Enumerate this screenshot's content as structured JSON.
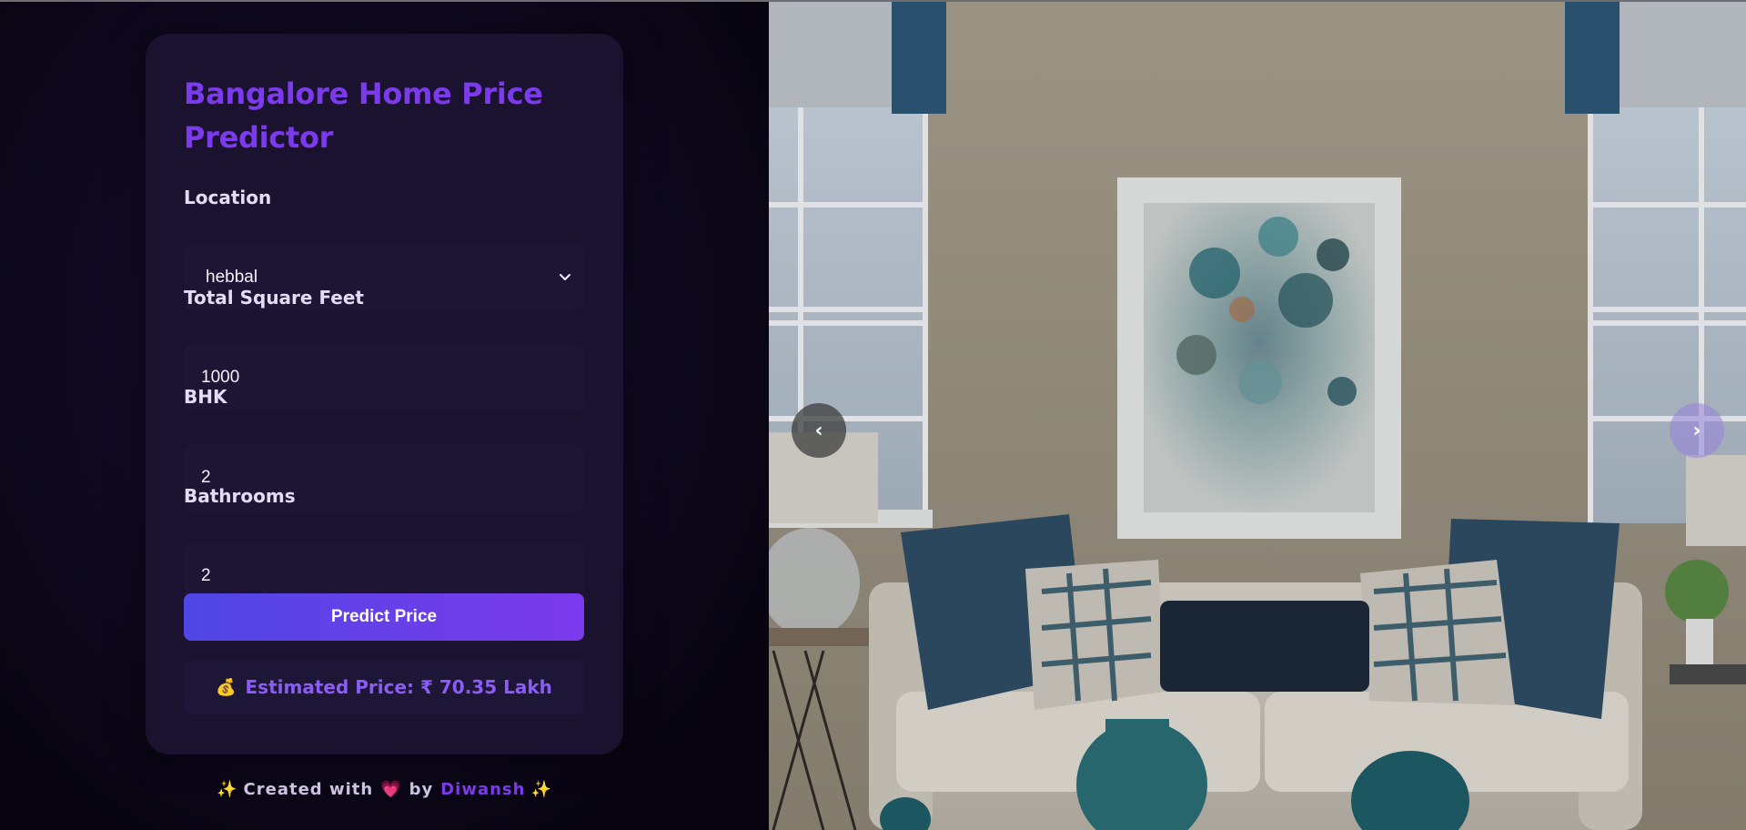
{
  "app": {
    "title": "Bangalore Home Price Predictor"
  },
  "form": {
    "location_label": "Location",
    "location_value": "hebbal",
    "sqft_label": "Total Square Feet",
    "sqft_value": "1000",
    "bhk_label": "BHK",
    "bhk_value": "2",
    "bath_label": "Bathrooms",
    "bath_value": "2",
    "submit_label": "Predict Price"
  },
  "result": {
    "icon": "money-bag-icon",
    "text": "Estimated Price: ₹ 70.35 Lakh"
  },
  "footer": {
    "prefix": "Created with",
    "by": "by",
    "author": "Diwansh"
  },
  "carousel": {
    "prev_label": "‹",
    "next_label": "›"
  },
  "colors": {
    "accent": "#7c3aed",
    "button_start": "#4f46e5",
    "button_end": "#7c3aed",
    "card_bg": "#1b1230",
    "page_bg": "#07040f"
  }
}
